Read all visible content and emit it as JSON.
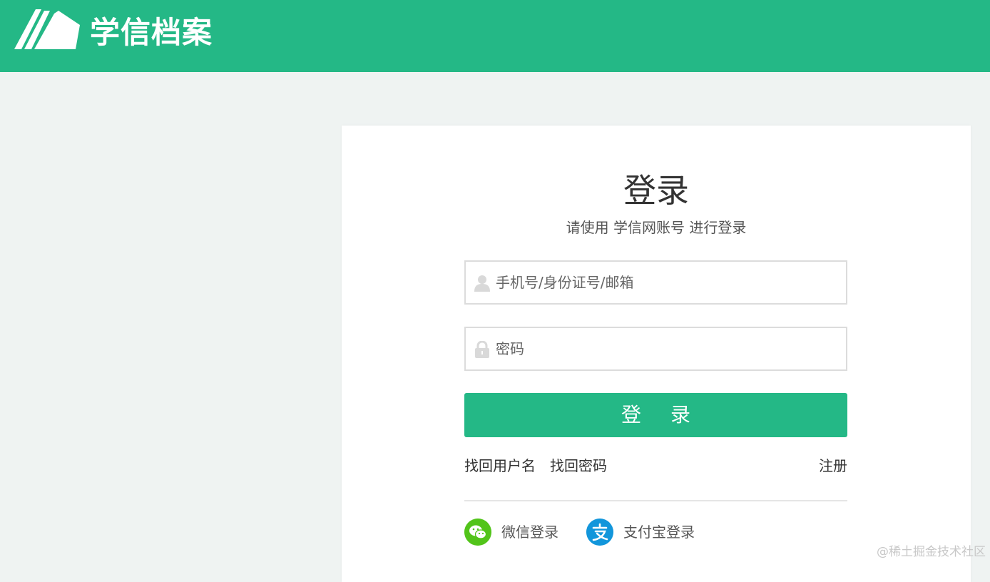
{
  "header": {
    "brand": "学信档案",
    "brand_color": "#24b886"
  },
  "login": {
    "title": "登录",
    "subtitle": "请使用 学信网账号 进行登录",
    "username": {
      "icon": "user-icon",
      "placeholder": "手机号/身份证号/邮箱",
      "value": ""
    },
    "password": {
      "icon": "lock-icon",
      "placeholder": "密码",
      "value": ""
    },
    "submit_label": "登 录",
    "links": {
      "find_username": "找回用户名",
      "find_password": "找回密码",
      "register": "注册"
    },
    "third_party": [
      {
        "icon": "wechat-icon",
        "label": "微信登录",
        "color": "#52c41a"
      },
      {
        "icon": "alipay-icon",
        "label": "支付宝登录",
        "color": "#1296db"
      }
    ]
  },
  "watermark": "@稀土掘金技术社区"
}
